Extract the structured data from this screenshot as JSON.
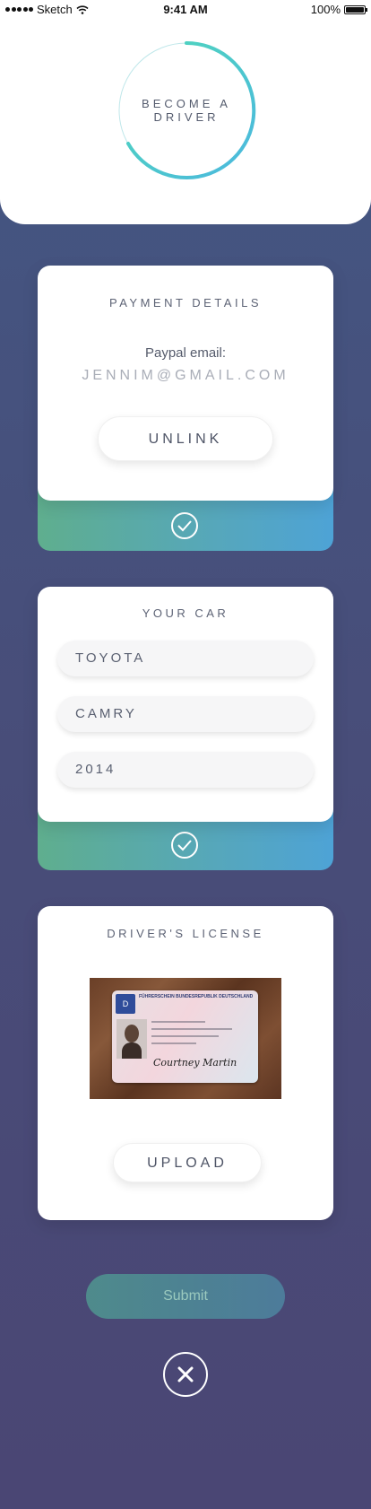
{
  "status_bar": {
    "carrier": "Sketch",
    "time": "9:41 AM",
    "battery": "100%"
  },
  "header": {
    "title_line1": "BECOME A",
    "title_line2": "DRIVER"
  },
  "payment": {
    "title": "PAYMENT DETAILS",
    "paypal_label": "Paypal email:",
    "paypal_email": "JENNIM@GMAIL.COM",
    "unlink_label": "UNLINK"
  },
  "car": {
    "title": "YOUR CAR",
    "make": "TOYOTA",
    "model": "CAMRY",
    "year": "2014"
  },
  "license": {
    "title": "DRIVER'S LICENSE",
    "card_header": "FÜHRERSCHEIN BUNDESREPUBLIK DEUTSCHLAND",
    "card_country": "D",
    "card_signature": "Courtney Martin",
    "upload_label": "UPLOAD"
  },
  "submit_label": "Submit",
  "colors": {
    "accent_teal": "#4fd3c4",
    "accent_blue": "#4ea3d6",
    "bg": "#484d79"
  },
  "icons": {
    "check": "check-circle-icon",
    "close": "close-circle-icon",
    "wifi": "wifi-icon"
  }
}
